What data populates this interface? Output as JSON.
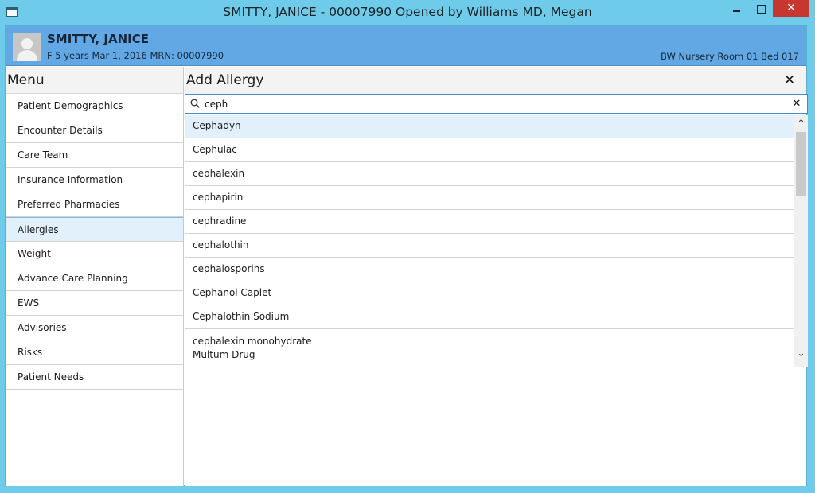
{
  "window": {
    "title": "SMITTY, JANICE - 00007990 Opened by Williams MD, Megan",
    "close_glyph": "✕"
  },
  "patient": {
    "name": "SMITTY, JANICE",
    "info": "F 5 years Mar 1, 2016 MRN: 00007990",
    "location": "BW Nursery Room 01 Bed 017"
  },
  "menu": {
    "title": "Menu",
    "active": "Allergies",
    "items": [
      "Patient Demographics",
      "Encounter Details",
      "Care Team",
      "Insurance Information",
      "Preferred Pharmacies",
      "Allergies",
      "Weight",
      "Advance Care Planning",
      "EWS",
      "Advisories",
      "Risks",
      "Patient Needs"
    ]
  },
  "content": {
    "title": "Add Allergy",
    "close_glyph": "✕"
  },
  "search": {
    "value": "ceph",
    "clear_glyph": "✕"
  },
  "results": {
    "selected": "Cephadyn",
    "items": [
      {
        "label": "Cephadyn"
      },
      {
        "label": "Cephulac"
      },
      {
        "label": "cephalexin"
      },
      {
        "label": "cephapirin"
      },
      {
        "label": "cephradine"
      },
      {
        "label": "cephalothin"
      },
      {
        "label": "cephalosporins"
      },
      {
        "label": "Cephanol Caplet"
      },
      {
        "label": "Cephalothin Sodium"
      },
      {
        "label": "cephalexin monohydrate",
        "sub": "Multum Drug"
      }
    ]
  },
  "scrollbar": {
    "up_glyph": "⌃",
    "down_glyph": "⌄"
  },
  "colors": {
    "titlebar": "#6fcbea",
    "banner": "#61a8e4",
    "selection": "#e1f0fb",
    "accent_border": "#3f8dcb",
    "close_button": "#c7372f"
  }
}
